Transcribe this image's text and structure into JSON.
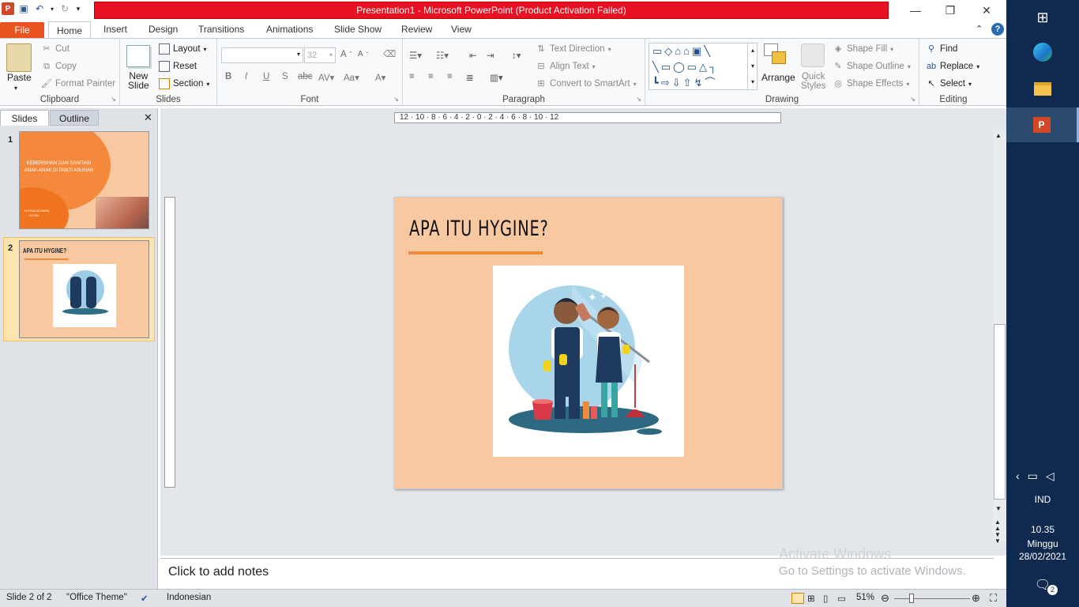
{
  "window": {
    "title": "Presentation1  -  Microsoft PowerPoint (Product Activation Failed)"
  },
  "tabs": [
    "File",
    "Home",
    "Insert",
    "Design",
    "Transitions",
    "Animations",
    "Slide Show",
    "Review",
    "View"
  ],
  "clipboard": {
    "paste": "Paste",
    "cut": "Cut",
    "copy": "Copy",
    "format_painter": "Format Painter",
    "label": "Clipboard"
  },
  "slides_group": {
    "new_slide": "New\nSlide",
    "layout": "Layout",
    "reset": "Reset",
    "section": "Section",
    "label": "Slides"
  },
  "font": {
    "size": "32",
    "label": "Font"
  },
  "paragraph": {
    "text_direction": "Text Direction",
    "align_text": "Align Text",
    "smartart": "Convert to SmartArt",
    "label": "Paragraph"
  },
  "drawing": {
    "arrange": "Arrange",
    "quick_styles": "Quick\nStyles",
    "shape_fill": "Shape Fill",
    "shape_outline": "Shape Outline",
    "shape_effects": "Shape Effects",
    "label": "Drawing"
  },
  "editing": {
    "find": "Find",
    "replace": "Replace",
    "select": "Select",
    "label": "Editing"
  },
  "left_pane": {
    "tab_slides": "Slides",
    "tab_outline": "Outline"
  },
  "thumb1": {
    "num": "1",
    "title": "KEBERSIHAN DAN SANITASI ANAK-ANAK DI PANTI ASUHAN",
    "author": "FUTRAH AZZAHRA",
    "id": "F01000"
  },
  "thumb2": {
    "num": "2",
    "title": "APA ITU HYGINE?"
  },
  "slide": {
    "title": "APA ITU HYGINE?"
  },
  "ruler": {
    "h_ticks": "12 · 10 · 8 · 6 · 4 · 2 · 0 · 2 · 4 · 6 · 8 · 10 · 12"
  },
  "notes": {
    "placeholder": "Click to add notes"
  },
  "watermark": {
    "line1": "Activate Windows",
    "line2": "Go to Settings to activate Windows."
  },
  "status": {
    "slide": "Slide 2 of 2",
    "theme": "\"Office Theme\"",
    "language": "Indonesian",
    "zoom": "51%"
  },
  "taskbar": {
    "lang": "IND",
    "time": "10.35",
    "day": "Minggu",
    "date": "28/02/2021",
    "notif": "2"
  },
  "colors": {
    "title_bar": "#e81123",
    "file_tab": "#e8531f",
    "slide_bg": "#f8c8a0",
    "accent_line": "#f08a3c",
    "taskbar": "#0f2a4e"
  }
}
